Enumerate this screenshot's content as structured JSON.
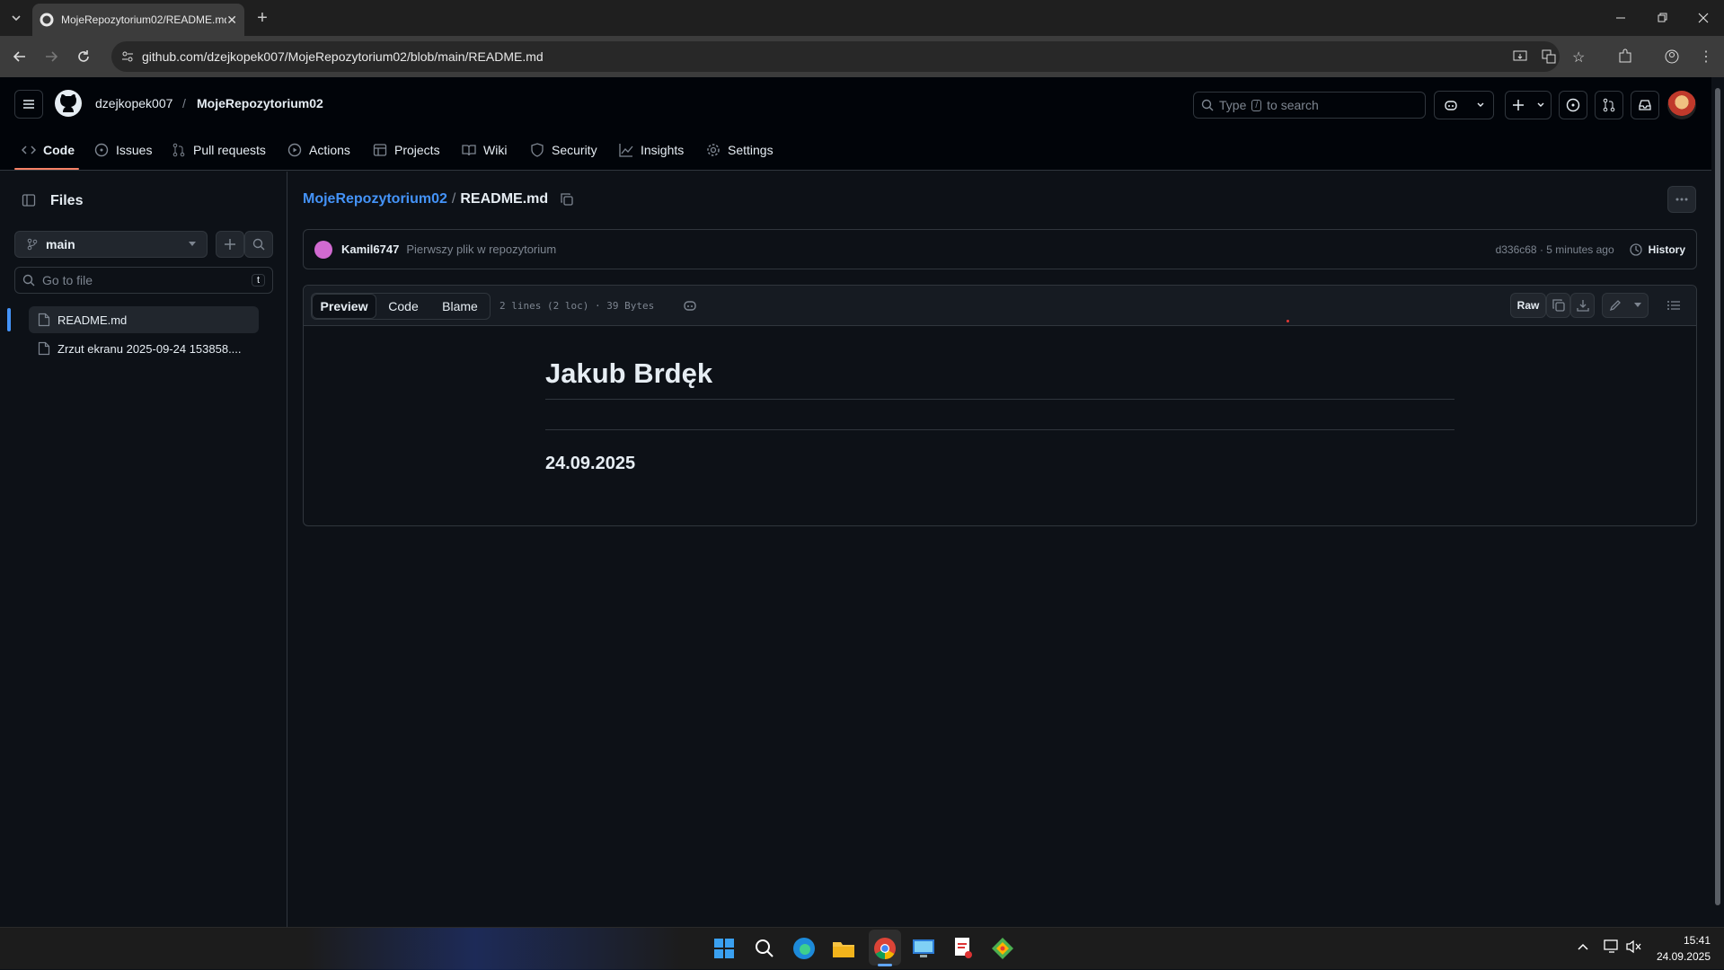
{
  "browser": {
    "tab_title": "MojeRepozytorium02/README.md",
    "url": "github.com/dzejkopek007/MojeRepozytorium02/blob/main/README.md"
  },
  "repo": {
    "owner": "dzejkopek007",
    "separator": "/",
    "name": "MojeRepozytorium02",
    "search_type": "Type",
    "search_key": "/",
    "search_rest": "to search"
  },
  "nav_tabs": [
    "Code",
    "Issues",
    "Pull requests",
    "Actions",
    "Projects",
    "Wiki",
    "Security",
    "Insights",
    "Settings"
  ],
  "sidebar": {
    "title": "Files",
    "branch": "main",
    "goto_placeholder": "Go to file",
    "goto_shortcut": "t",
    "files": [
      "README.md",
      "Zrzut ekranu 2025-09-24 153858...."
    ]
  },
  "breadcrumb": {
    "repo": "MojeRepozytorium02",
    "sep": "/",
    "file": "README.md"
  },
  "commit": {
    "author": "Kamil6747",
    "message": "Pierwszy plik w repozytorium",
    "hash_time": "d336c68 · 5 minutes ago",
    "history": "History"
  },
  "file_view": {
    "tabs": [
      "Preview",
      "Code",
      "Blame"
    ],
    "meta": "2 lines (2 loc) · 39 Bytes",
    "raw": "Raw"
  },
  "content": {
    "heading": "Jakub Brdęk",
    "date": "24.09.2025"
  },
  "taskbar": {
    "time": "15:41",
    "date": "24.09.2025"
  },
  "colors": {
    "bg": "#0d1117",
    "link": "#4493f8",
    "accent": "#f78166",
    "border": "#30363d"
  }
}
